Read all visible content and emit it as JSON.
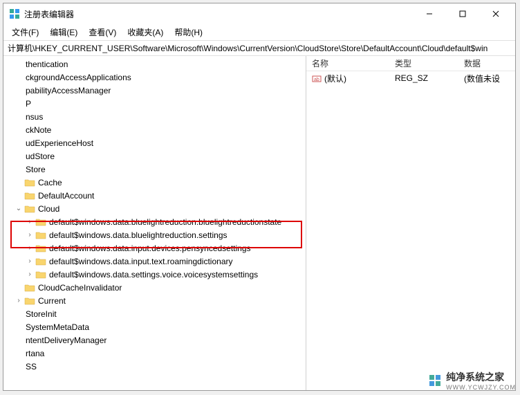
{
  "window": {
    "title": "注册表编辑器"
  },
  "menu": {
    "file": "文件(F)",
    "edit": "编辑(E)",
    "view": "查看(V)",
    "favorites": "收藏夹(A)",
    "help": "帮助(H)"
  },
  "address": {
    "path": "计算机\\HKEY_CURRENT_USER\\Software\\Microsoft\\Windows\\CurrentVersion\\CloudStore\\Store\\DefaultAccount\\Cloud\\default$win"
  },
  "tree": {
    "items": [
      {
        "indent": 0,
        "caret": "",
        "folder": false,
        "label": "thentication"
      },
      {
        "indent": 0,
        "caret": "",
        "folder": false,
        "label": "ckgroundAccessApplications"
      },
      {
        "indent": 0,
        "caret": "",
        "folder": false,
        "label": "pabilityAccessManager"
      },
      {
        "indent": 0,
        "caret": "",
        "folder": false,
        "label": "P"
      },
      {
        "indent": 0,
        "caret": "",
        "folder": false,
        "label": "nsus"
      },
      {
        "indent": 0,
        "caret": "",
        "folder": false,
        "label": "ckNote"
      },
      {
        "indent": 0,
        "caret": "",
        "folder": false,
        "label": "udExperienceHost"
      },
      {
        "indent": 0,
        "caret": "",
        "folder": false,
        "label": "udStore"
      },
      {
        "indent": 0,
        "caret": "",
        "folder": false,
        "label": "Store"
      },
      {
        "indent": 1,
        "caret": "",
        "folder": true,
        "label": "Cache"
      },
      {
        "indent": 1,
        "caret": "",
        "folder": true,
        "label": "DefaultAccount"
      },
      {
        "indent": 1,
        "caret": "v",
        "folder": true,
        "label": "Cloud"
      },
      {
        "indent": 2,
        "caret": ">",
        "folder": true,
        "label": "default$windows.data.bluelightreduction.bluelightreductionstate"
      },
      {
        "indent": 2,
        "caret": ">",
        "folder": true,
        "label": "default$windows.data.bluelightreduction.settings"
      },
      {
        "indent": 2,
        "caret": ">",
        "folder": true,
        "label": "default$windows.data.input.devices.pensyncedsettings"
      },
      {
        "indent": 2,
        "caret": ">",
        "folder": true,
        "label": "default$windows.data.input.text.roamingdictionary"
      },
      {
        "indent": 2,
        "caret": ">",
        "folder": true,
        "label": "default$windows.data.settings.voice.voicesystemsettings"
      },
      {
        "indent": 1,
        "caret": "",
        "folder": true,
        "label": "CloudCacheInvalidator"
      },
      {
        "indent": 1,
        "caret": ">",
        "folder": true,
        "label": "Current"
      },
      {
        "indent": 0,
        "caret": "",
        "folder": false,
        "label": "StoreInit"
      },
      {
        "indent": 0,
        "caret": "",
        "folder": false,
        "label": "SystemMetaData"
      },
      {
        "indent": 0,
        "caret": "",
        "folder": false,
        "label": "ntentDeliveryManager"
      },
      {
        "indent": 0,
        "caret": "",
        "folder": false,
        "label": "rtana"
      },
      {
        "indent": 0,
        "caret": "",
        "folder": false,
        "label": "SS"
      }
    ]
  },
  "list": {
    "headers": {
      "name": "名称",
      "type": "类型",
      "data": "数据"
    },
    "rows": [
      {
        "name": "(默认)",
        "type": "REG_SZ",
        "data": "(数值未设"
      }
    ]
  },
  "watermark": {
    "brand": "纯净系统之家",
    "url": "WWW.YCWJZY.COM"
  }
}
